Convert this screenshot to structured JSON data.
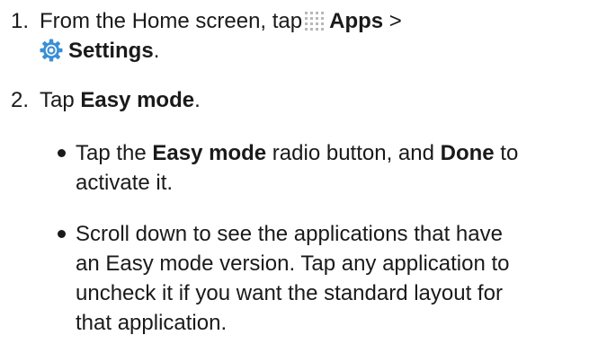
{
  "steps": [
    {
      "number": "1.",
      "lines": [
        {
          "pre": "From the Home screen, tap",
          "apps_label": "Apps",
          "post": ">"
        },
        {
          "settings_label": "Settings",
          "post": "."
        }
      ],
      "icons": [
        "apps-grid-icon",
        "settings-gear-icon"
      ]
    },
    {
      "number": "2.",
      "pre": "Tap ",
      "bold": "Easy mode",
      "post": "."
    }
  ],
  "bullets": [
    {
      "lines": [
        {
          "pre": "Tap the ",
          "bold1": "Easy mode",
          "mid": " radio button, and ",
          "bold2": "Done",
          "post": " to"
        },
        {
          "text": "activate it."
        }
      ]
    },
    {
      "lines": [
        "Scroll down to see the applications that have",
        "an Easy mode version. Tap any application to",
        "uncheck it if you want the standard layout for",
        "that application."
      ]
    }
  ],
  "colors": {
    "text": "#1a1a1a",
    "settings_icon_blue": "#3a8fd6",
    "apps_icon_dots": "#b8b8b8"
  }
}
